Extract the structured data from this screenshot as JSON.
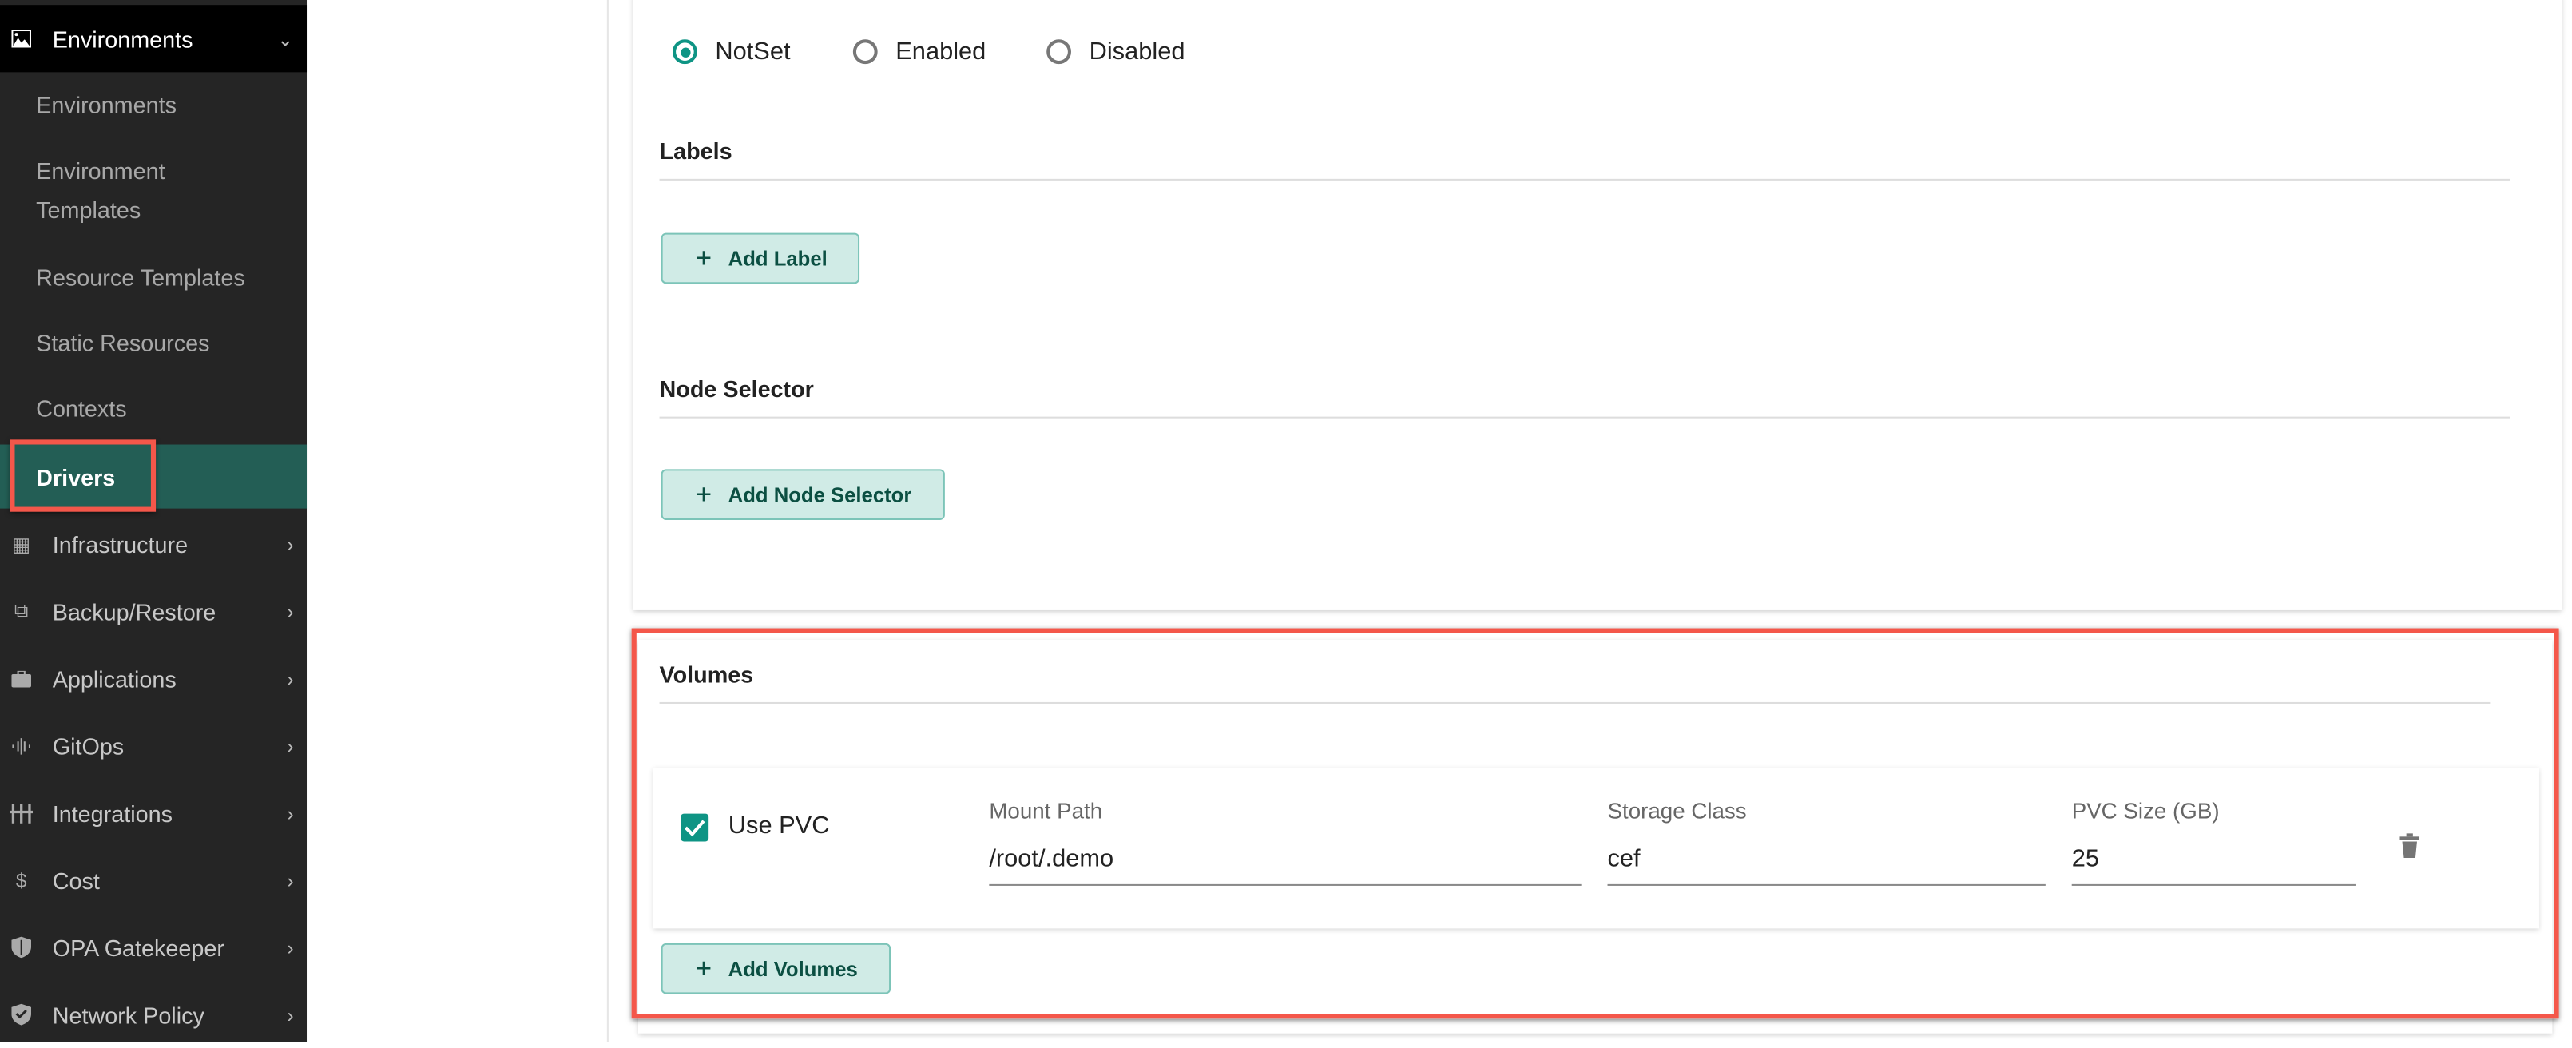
{
  "sidebar": {
    "section": {
      "label": "Environments",
      "icon": "image-icon",
      "expanded": true
    },
    "sub_items": [
      {
        "label": "Environments"
      },
      {
        "label": "Environment Templates"
      },
      {
        "label": "Resource Templates"
      },
      {
        "label": "Static Resources"
      },
      {
        "label": "Contexts"
      },
      {
        "label": "Drivers",
        "active": true
      }
    ],
    "items": [
      {
        "label": "Infrastructure",
        "icon": "building-icon"
      },
      {
        "label": "Backup/Restore",
        "icon": "layers-icon"
      },
      {
        "label": "Applications",
        "icon": "briefcase-icon"
      },
      {
        "label": "GitOps",
        "icon": "waveform-icon"
      },
      {
        "label": "Integrations",
        "icon": "plug-icon"
      },
      {
        "label": "Cost",
        "icon": "dollar-icon"
      },
      {
        "label": "OPA Gatekeeper",
        "icon": "shield-half-icon"
      },
      {
        "label": "Network Policy",
        "icon": "shield-check-icon"
      }
    ]
  },
  "form": {
    "radios": [
      {
        "label": "NotSet",
        "selected": true
      },
      {
        "label": "Enabled",
        "selected": false
      },
      {
        "label": "Disabled",
        "selected": false
      }
    ],
    "labels_heading": "Labels",
    "add_label": "Add Label",
    "node_selector_heading": "Node Selector",
    "add_node_selector": "Add Node Selector",
    "volumes": {
      "heading": "Volumes",
      "use_pvc_label": "Use PVC",
      "use_pvc_checked": true,
      "mount_path_label": "Mount Path",
      "mount_path_value": "/root/.demo",
      "storage_class_label": "Storage Class",
      "storage_class_value": "cef",
      "pvc_size_label": "PVC Size (GB)",
      "pvc_size_value": "25",
      "add_volumes": "Add Volumes"
    }
  },
  "colors": {
    "accent": "#0e9484",
    "active_nav": "#235e55",
    "highlight": "#f4574a",
    "button_bg": "#d0ebe6"
  }
}
